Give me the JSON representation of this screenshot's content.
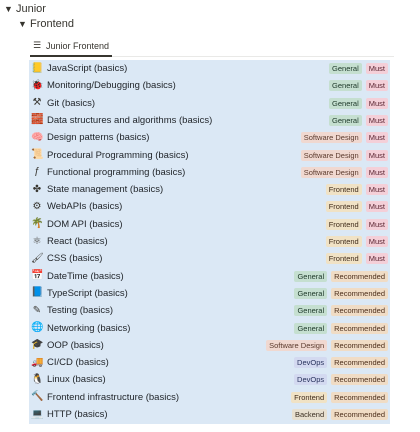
{
  "tree": {
    "level1": {
      "label": "Junior"
    },
    "level2": {
      "label": "Frontend"
    }
  },
  "view_tab": {
    "label": "Junior Frontend",
    "icon": "list-icon"
  },
  "rows": [
    {
      "icon": "javascript-icon",
      "glyph": "📒",
      "title": "JavaScript (basics)",
      "tags": [
        "General",
        "Must"
      ]
    },
    {
      "icon": "bug-icon",
      "glyph": "🐞",
      "title": "Monitoring/Debugging (basics)",
      "tags": [
        "General",
        "Must"
      ]
    },
    {
      "icon": "git-icon",
      "glyph": "⚒",
      "title": "Git (basics)",
      "tags": [
        "General",
        "Must"
      ]
    },
    {
      "icon": "brick-icon",
      "glyph": "🧱",
      "title": "Data structures and algorithms (basics)",
      "tags": [
        "General",
        "Must"
      ]
    },
    {
      "icon": "brain-icon",
      "glyph": "🧠",
      "title": "Design patterns (basics)",
      "tags": [
        "Software Design",
        "Must"
      ]
    },
    {
      "icon": "scroll-icon",
      "glyph": "📜",
      "title": "Procedural Programming (basics)",
      "tags": [
        "Software Design",
        "Must"
      ]
    },
    {
      "icon": "function-icon",
      "glyph": "ƒ",
      "title": "Functional programming (basics)",
      "tags": [
        "Software Design",
        "Must"
      ]
    },
    {
      "icon": "puzzle-icon",
      "glyph": "✤",
      "title": "State management (basics)",
      "tags": [
        "Frontend",
        "Must"
      ]
    },
    {
      "icon": "gear-icon",
      "glyph": "⚙",
      "title": "WebAPIs (basics)",
      "tags": [
        "Frontend",
        "Must"
      ]
    },
    {
      "icon": "tree-icon",
      "glyph": "🌴",
      "title": "DOM API (basics)",
      "tags": [
        "Frontend",
        "Must"
      ]
    },
    {
      "icon": "react-icon",
      "glyph": "⚛",
      "title": "React (basics)",
      "tags": [
        "Frontend",
        "Must"
      ]
    },
    {
      "icon": "brush-icon",
      "glyph": "🖌",
      "title": "CSS (basics)",
      "tags": [
        "Frontend",
        "Must"
      ]
    },
    {
      "icon": "calendar-icon",
      "glyph": "📅",
      "title": "DateTime (basics)",
      "tags": [
        "General",
        "Recommended"
      ]
    },
    {
      "icon": "typescript-icon",
      "glyph": "📘",
      "title": "TypeScript (basics)",
      "tags": [
        "General",
        "Recommended"
      ]
    },
    {
      "icon": "pencil-icon",
      "glyph": "✎",
      "title": "Testing (basics)",
      "tags": [
        "General",
        "Recommended"
      ]
    },
    {
      "icon": "globe-icon",
      "glyph": "🌐",
      "title": "Networking (basics)",
      "tags": [
        "General",
        "Recommended"
      ]
    },
    {
      "icon": "graduation-cap-icon",
      "glyph": "🎓",
      "title": "OOP (basics)",
      "tags": [
        "Software Design",
        "Recommended"
      ]
    },
    {
      "icon": "truck-icon",
      "glyph": "🚚",
      "title": "CI/CD (basics)",
      "tags": [
        "DevOps",
        "Recommended"
      ]
    },
    {
      "icon": "penguin-icon",
      "glyph": "🐧",
      "title": "Linux (basics)",
      "tags": [
        "DevOps",
        "Recommended"
      ]
    },
    {
      "icon": "hammer-icon",
      "glyph": "🔨",
      "title": "Frontend infrastructure (basics)",
      "tags": [
        "Frontend",
        "Recommended"
      ]
    },
    {
      "icon": "monitor-icon",
      "glyph": "💻",
      "title": "HTTP (basics)",
      "tags": [
        "Backend",
        "Recommended"
      ]
    }
  ],
  "tag_classes": {
    "General": "t-general",
    "Software Design": "t-sd",
    "Frontend": "t-frontend",
    "DevOps": "t-devops",
    "Backend": "t-backend",
    "Must": "t-must",
    "Recommended": "t-recommended"
  }
}
